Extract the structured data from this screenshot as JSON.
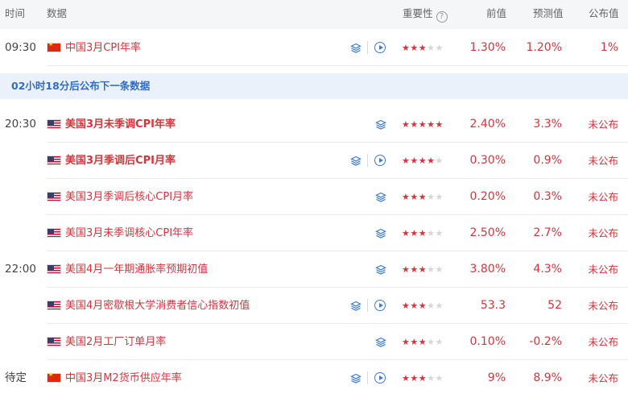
{
  "header": {
    "time": "时间",
    "data": "数据",
    "importance": "重要性",
    "help": "?",
    "previous": "前值",
    "forecast": "预测值",
    "actual": "公布值"
  },
  "notice": "02小时18分后公布下一条数据",
  "times": [
    "09:30",
    "20:30",
    "22:00",
    "待定"
  ],
  "colors": {
    "accent": "#d4353d",
    "link_blue": "#3b7bd6",
    "notice_bg": "#eaf1fb",
    "notice_text": "#2e6cc8",
    "header_bg": "#f5f6f8"
  },
  "icons": {
    "flag_cn": "china-flag-icon",
    "flag_us": "us-flag-icon",
    "layers": "layers-icon",
    "play": "play-circle-icon",
    "star": "star-icon"
  },
  "rows": [
    {
      "name": "中国3月CPI年率",
      "flag": "cn",
      "stars": 3,
      "prev": "1.30%",
      "forecast": "1.20%",
      "actual": "1%",
      "bold": false,
      "play": true
    },
    {
      "name": "美国3月未季调CPI年率",
      "flag": "us",
      "stars": 5,
      "prev": "2.40%",
      "forecast": "3.3%",
      "actual": "未公布",
      "bold": true,
      "play": false
    },
    {
      "name": "美国3月季调后CPI月率",
      "flag": "us",
      "stars": 4,
      "prev": "0.30%",
      "forecast": "0.9%",
      "actual": "未公布",
      "bold": true,
      "play": true
    },
    {
      "name": "美国3月季调后核心CPI月率",
      "flag": "us",
      "stars": 3,
      "prev": "0.20%",
      "forecast": "0.3%",
      "actual": "未公布",
      "bold": false,
      "play": false
    },
    {
      "name": "美国3月未季调核心CPI年率",
      "flag": "us",
      "stars": 3,
      "prev": "2.50%",
      "forecast": "2.7%",
      "actual": "未公布",
      "bold": false,
      "play": false
    },
    {
      "name": "美国4月一年期通胀率预期初值",
      "flag": "us",
      "stars": 3,
      "prev": "3.80%",
      "forecast": "4.3%",
      "actual": "未公布",
      "bold": false,
      "play": false
    },
    {
      "name": "美国4月密歇根大学消费者信心指数初值",
      "flag": "us",
      "stars": 3,
      "prev": "53.3",
      "forecast": "52",
      "actual": "未公布",
      "bold": false,
      "play": true
    },
    {
      "name": "美国2月工厂订单月率",
      "flag": "us",
      "stars": 3,
      "prev": "0.10%",
      "forecast": "-0.2%",
      "actual": "未公布",
      "bold": false,
      "play": false
    },
    {
      "name": "中国3月M2货币供应年率",
      "flag": "cn",
      "stars": 3,
      "prev": "9%",
      "forecast": "8.9%",
      "actual": "未公布",
      "bold": false,
      "play": true
    }
  ]
}
